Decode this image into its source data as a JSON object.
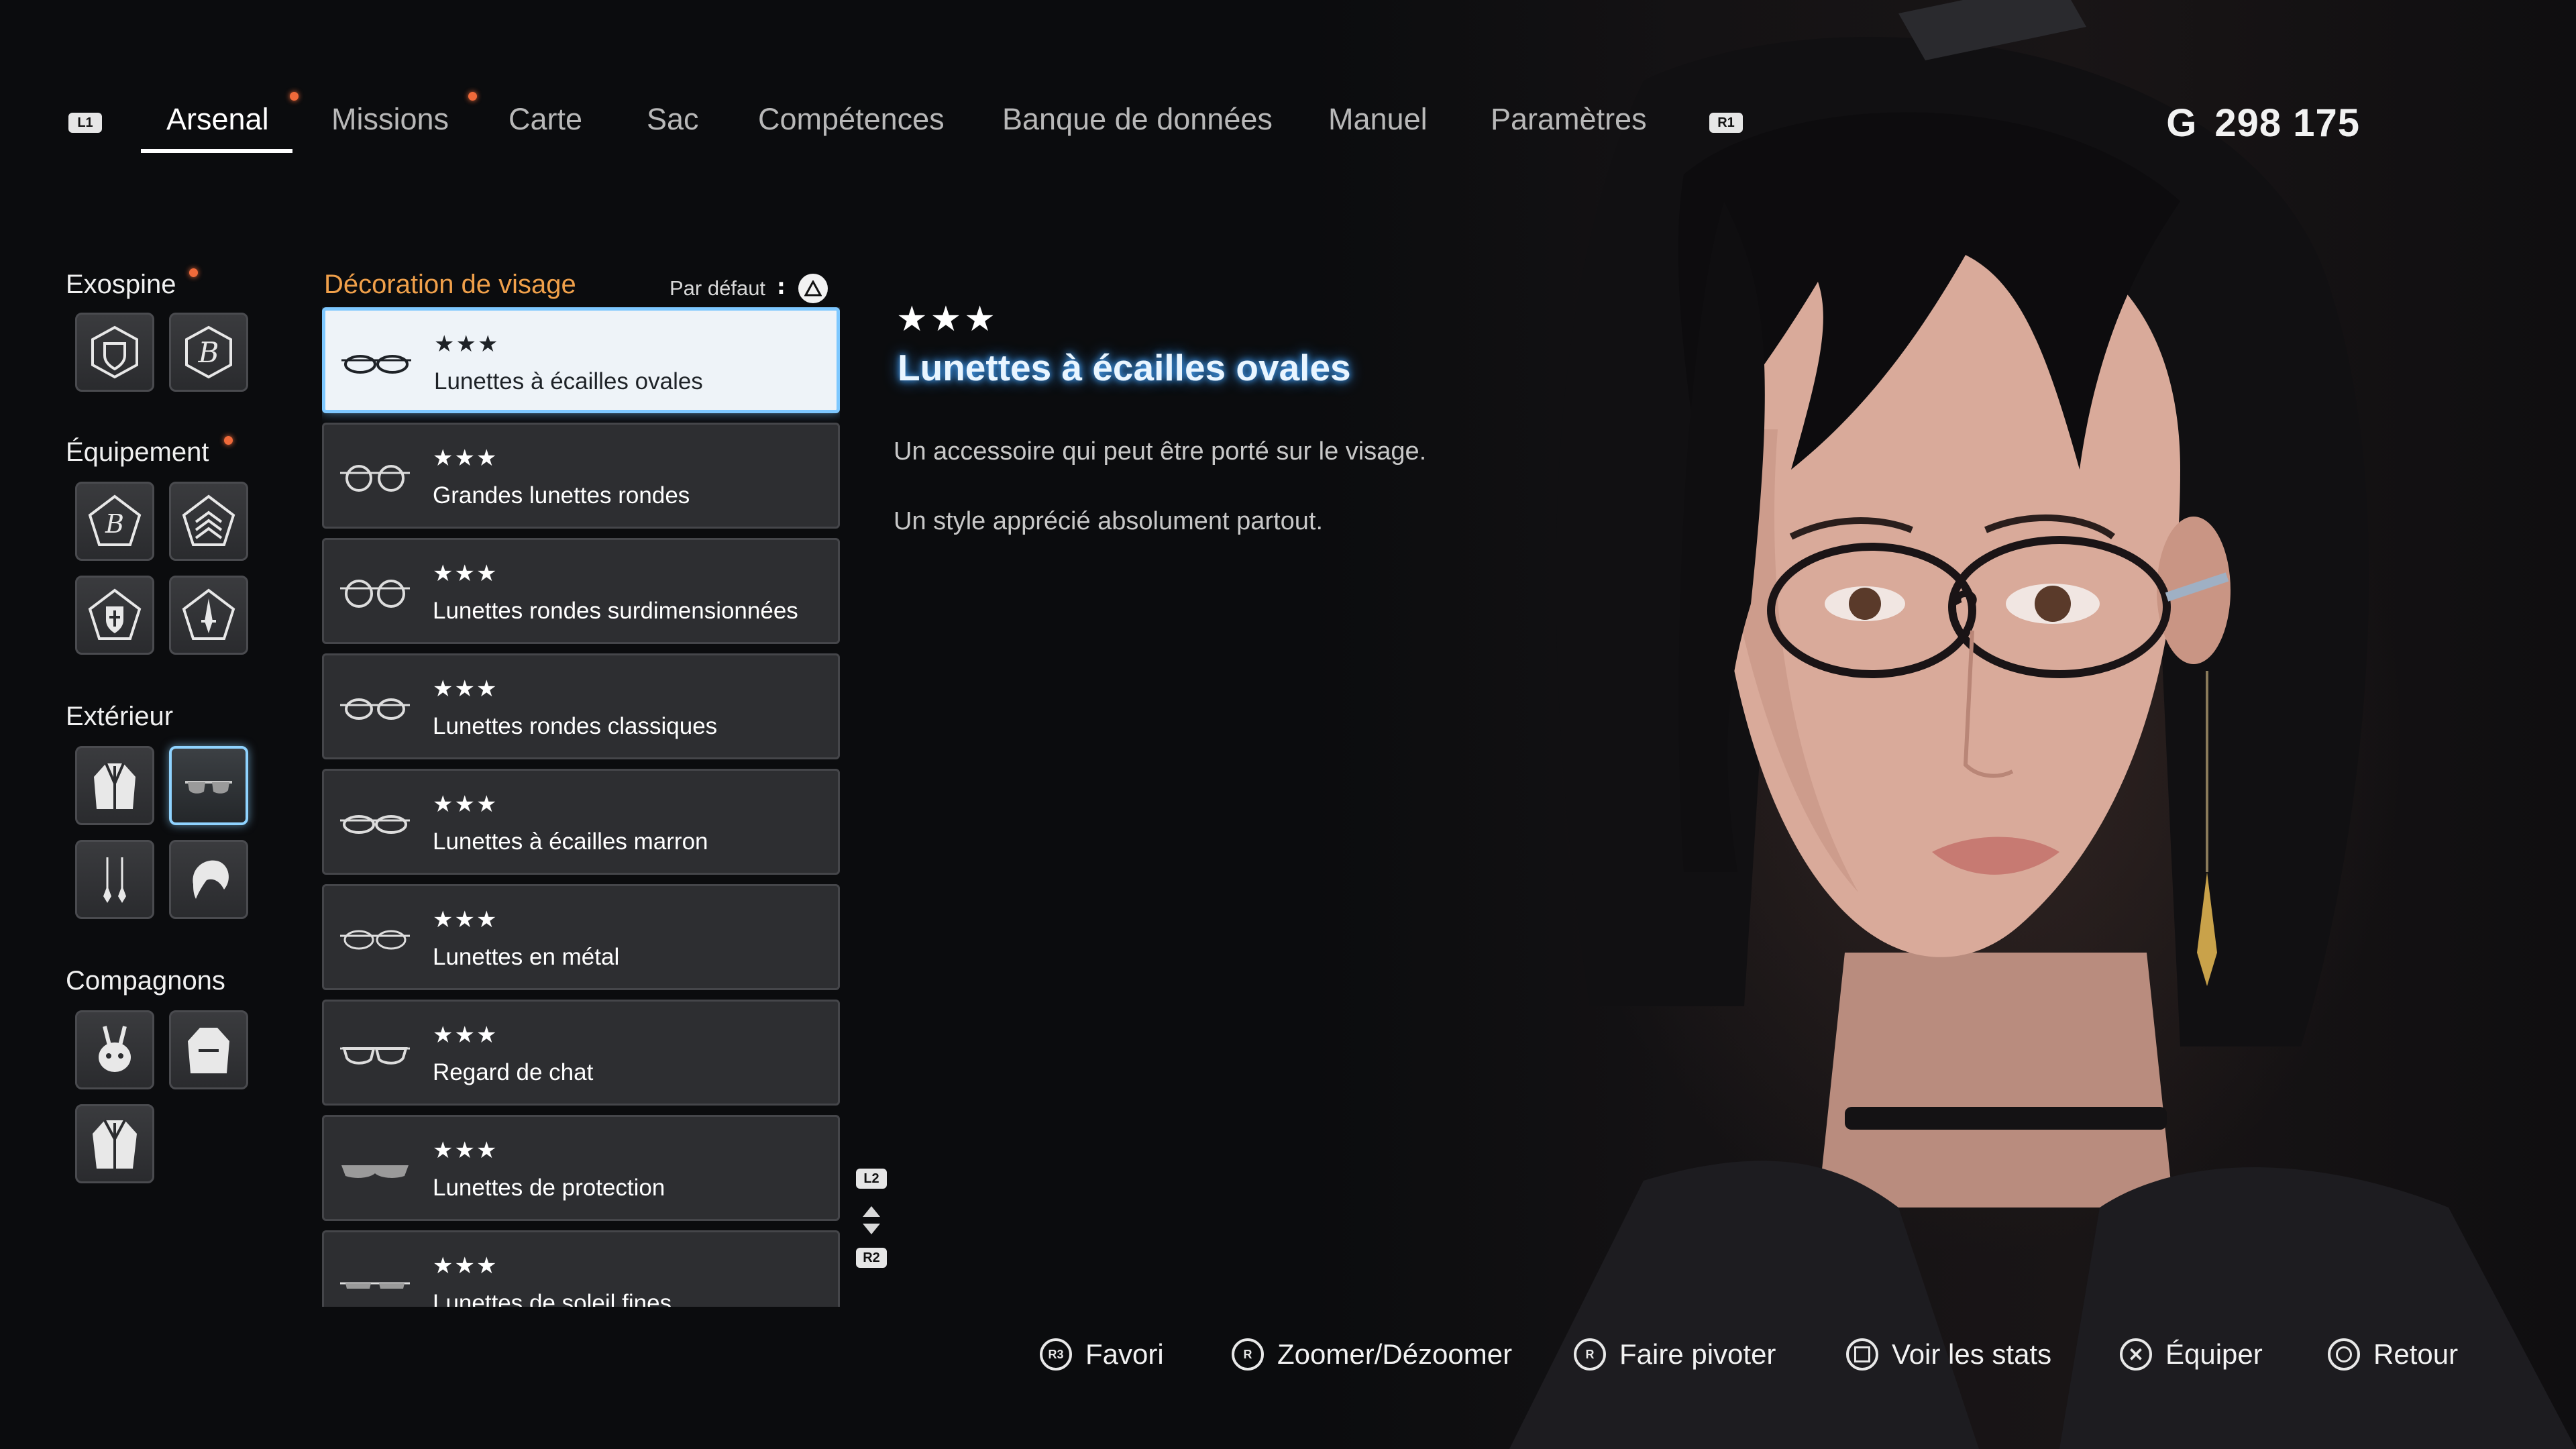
{
  "top_nav": {
    "left_bumper": "L1",
    "right_bumper": "R1",
    "tabs": [
      {
        "label": "Arsenal",
        "active": true,
        "notification": true
      },
      {
        "label": "Missions",
        "active": false,
        "notification": true
      },
      {
        "label": "Carte",
        "active": false,
        "notification": false
      },
      {
        "label": "Sac",
        "active": false,
        "notification": false
      },
      {
        "label": "Compétences",
        "active": false,
        "notification": false
      },
      {
        "label": "Banque de données",
        "active": false,
        "notification": false
      },
      {
        "label": "Manuel",
        "active": false,
        "notification": false
      },
      {
        "label": "Paramètres",
        "active": false,
        "notification": false
      }
    ],
    "currency_symbol": "G",
    "currency_value": "298 175"
  },
  "categories": [
    {
      "title": "Exospine",
      "notification": true,
      "slots": [
        "exospine-shield-icon",
        "exospine-b-icon"
      ]
    },
    {
      "title": "Équipement",
      "notification": true,
      "slots": [
        "gear-b-pentagon-icon",
        "gear-chevrons-icon",
        "gear-shield-cross-icon",
        "gear-dagger-icon"
      ]
    },
    {
      "title": "Extérieur",
      "notification": false,
      "slots": [
        "outfit-jacket-icon",
        "sunglasses-icon",
        "earrings-icon",
        "hairstyle-icon"
      ],
      "selected_index": 1
    },
    {
      "title": "Compagnons",
      "notification": false,
      "slots": [
        "drone-bunny-icon",
        "companion-jacket-icon",
        "companion-coat-icon"
      ]
    }
  ],
  "list": {
    "header": "Décoration de visage",
    "sort_label": "Par défaut",
    "sort_button": "triangle",
    "items": [
      {
        "stars": "★★★",
        "name": "Lunettes à écailles ovales",
        "selected": true,
        "style": "oval"
      },
      {
        "stars": "★★★",
        "name": "Grandes lunettes rondes",
        "selected": false,
        "style": "round"
      },
      {
        "stars": "★★★",
        "name": "Lunettes rondes surdimensionnées",
        "selected": false,
        "style": "round"
      },
      {
        "stars": "★★★",
        "name": "Lunettes rondes classiques",
        "selected": false,
        "style": "round"
      },
      {
        "stars": "★★★",
        "name": "Lunettes à écailles marron",
        "selected": false,
        "style": "oval"
      },
      {
        "stars": "★★★",
        "name": "Lunettes en métal",
        "selected": false,
        "style": "oval"
      },
      {
        "stars": "★★★",
        "name": "Regard de chat",
        "selected": false,
        "style": "cat"
      },
      {
        "stars": "★★★",
        "name": "Lunettes de protection",
        "selected": false,
        "style": "shades"
      },
      {
        "stars": "★★★",
        "name": "Lunettes de soleil fines",
        "selected": false,
        "style": "thin"
      }
    ],
    "scroll_up_button": "L2",
    "scroll_down_button": "R2"
  },
  "detail": {
    "stars": "★★★",
    "title": "Lunettes à écailles ovales",
    "description_1": "Un accessoire qui peut être porté sur le visage.",
    "description_2": "Un style apprécié absolument partout."
  },
  "prompts": [
    {
      "icon": "r3",
      "label": "Favori"
    },
    {
      "icon": "r",
      "label": "Zoomer/Dézoomer"
    },
    {
      "icon": "r-rotate",
      "label": "Faire pivoter"
    },
    {
      "icon": "square",
      "label": "Voir les stats"
    },
    {
      "icon": "cross",
      "label": "Équiper"
    },
    {
      "icon": "circle",
      "label": "Retour"
    }
  ],
  "colors": {
    "accent_blue": "#7ec8ff",
    "notification_orange": "#f06a3a",
    "list_header_orange": "#f0a04a"
  }
}
